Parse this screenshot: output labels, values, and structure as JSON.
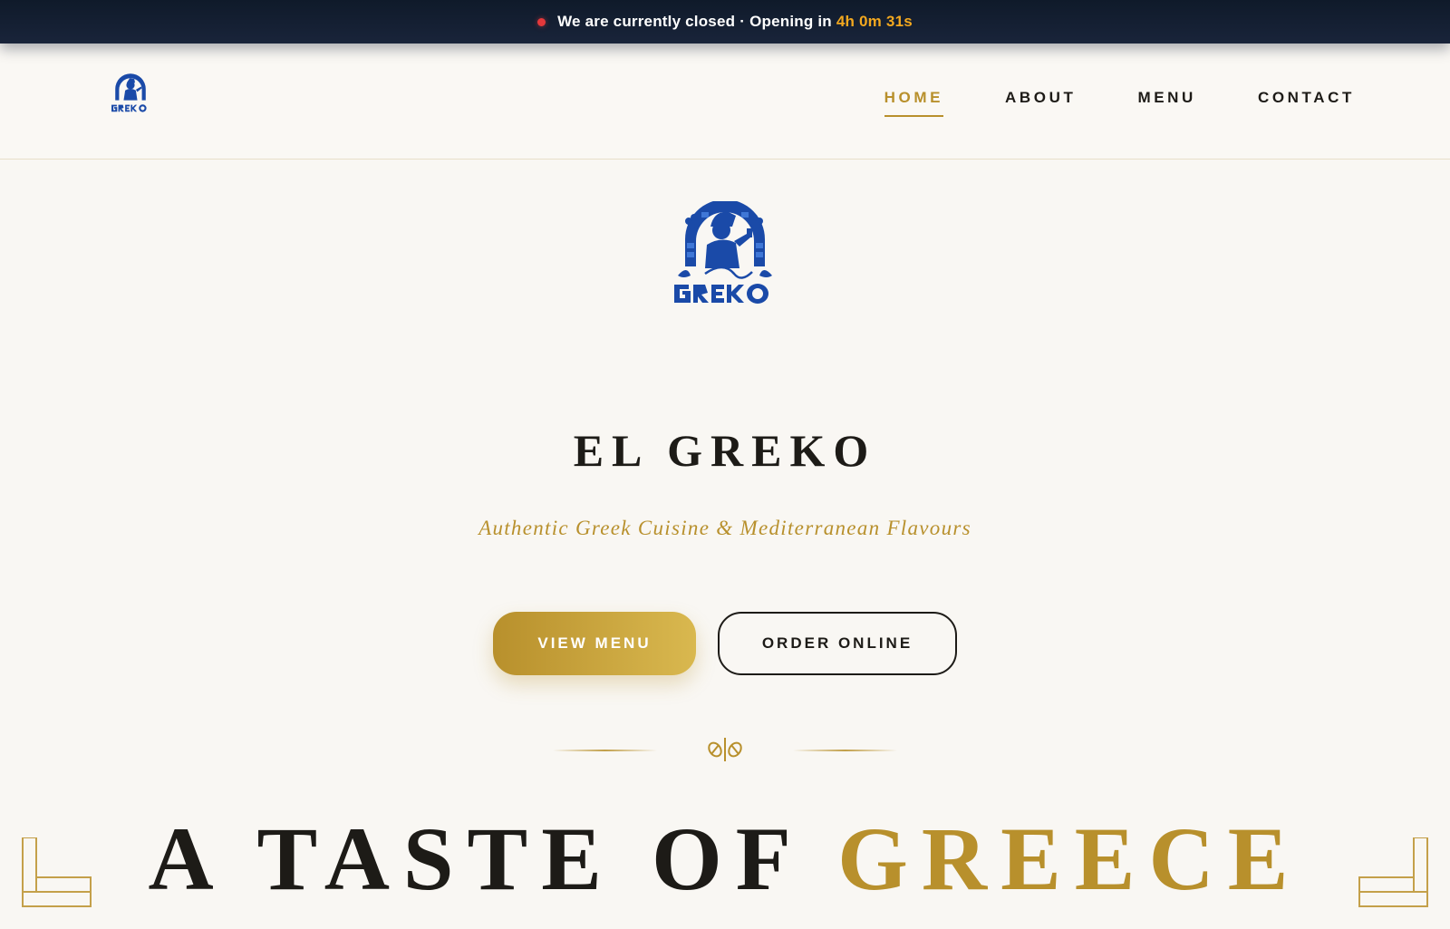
{
  "announcement": {
    "status_text": "We are currently closed",
    "separator": "·",
    "opening_prefix": "Opening in",
    "countdown": "4h 0m 31s",
    "status_color": "#e5383b",
    "countdown_color": "#f3a81f"
  },
  "nav": {
    "logo_icon": "el-greko-logo",
    "items": [
      {
        "label": "HOME",
        "active": true
      },
      {
        "label": "ABOUT",
        "active": false
      },
      {
        "label": "MENU",
        "active": false
      },
      {
        "label": "CONTACT",
        "active": false
      }
    ],
    "active_color": "#b8902c"
  },
  "hero": {
    "logo_icon": "el-greko-logo",
    "title": "EL GREKO",
    "tagline": "Authentic Greek Cuisine & Mediterranean Flavours",
    "primary_button": "VIEW MENU",
    "secondary_button": "ORDER ONLINE",
    "divider_icon": "olive-leaf-ornament-icon"
  },
  "section": {
    "heading_main": "A TASTE OF",
    "heading_accent": "GREECE",
    "corner_icon": "greek-key-corner-icon"
  },
  "colors": {
    "gold": "#b8902c",
    "navy": "#0f1a2a",
    "brand_blue": "#1a4aa8",
    "background": "#f9f7f3"
  }
}
